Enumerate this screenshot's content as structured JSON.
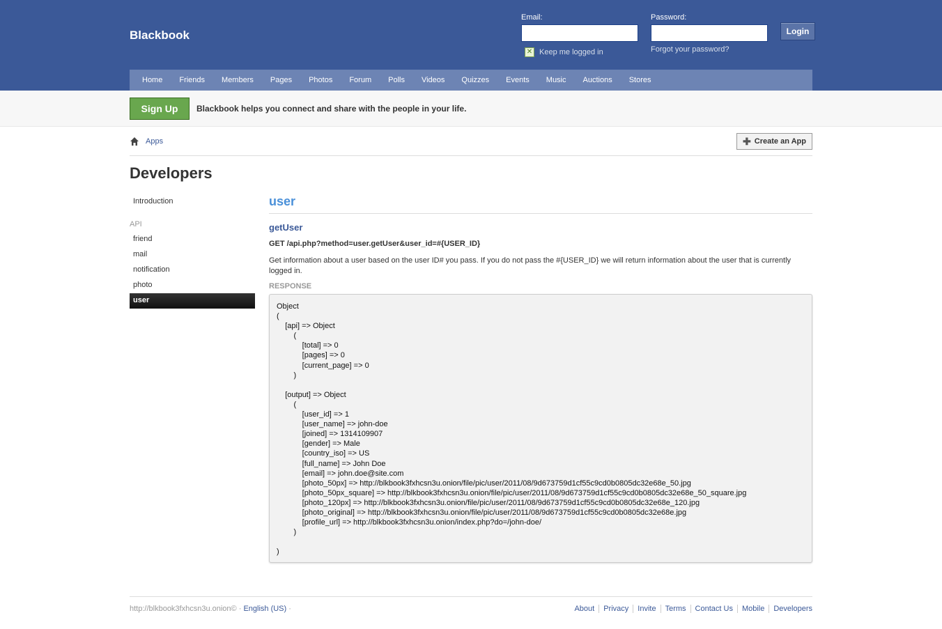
{
  "header": {
    "logo": "Blackbook",
    "email_label": "Email:",
    "password_label": "Password:",
    "email_value": "",
    "password_value": "",
    "login_label": "Login",
    "keep_logged_in": "Keep me logged in",
    "forgot_password": "Forgot your password?"
  },
  "nav": [
    "Home",
    "Friends",
    "Members",
    "Pages",
    "Photos",
    "Forum",
    "Polls",
    "Videos",
    "Quizzes",
    "Events",
    "Music",
    "Auctions",
    "Stores"
  ],
  "signup": {
    "button": "Sign Up",
    "tagline": "Blackbook helps you connect and share with the people in your life."
  },
  "breadcrumb": {
    "item": "Apps"
  },
  "create_app_label": "Create an App",
  "page_title": "Developers",
  "sidebar": {
    "intro": "Introduction",
    "section": "API",
    "items": [
      "friend",
      "mail",
      "notification",
      "photo",
      "user"
    ],
    "active": "user"
  },
  "content": {
    "title": "user",
    "method": "getUser",
    "endpoint": "GET /api.php?method=user.getUser&user_id=#{USER_ID}",
    "description": "Get information about a user based on the user ID# you pass. If you do not pass the #{USER_ID} we will return information about the user that is currently logged in.",
    "response_label": "RESPONSE",
    "response_lines": [
      "Object",
      "(",
      "    [api] => Object",
      "        (",
      "            [total] => 0",
      "            [pages] => 0",
      "            [current_page] => 0",
      "        )",
      "",
      "    [output] => Object",
      "        (",
      "            [user_id] => 1",
      "            [user_name] => john-doe",
      "            [joined] => 1314109907",
      "            [gender] => Male",
      "            [country_iso] => US",
      "            [full_name] => John Doe",
      "            [email] => john.doe@site.com",
      "            [photo_50px] => http://blkbook3fxhcsn3u.onion/file/pic/user/2011/08/9d673759d1cf55c9cd0b0805dc32e68e_50.jpg",
      "            [photo_50px_square] => http://blkbook3fxhcsn3u.onion/file/pic/user/2011/08/9d673759d1cf55c9cd0b0805dc32e68e_50_square.jpg",
      "            [photo_120px] => http://blkbook3fxhcsn3u.onion/file/pic/user/2011/08/9d673759d1cf55c9cd0b0805dc32e68e_120.jpg",
      "            [photo_original] => http://blkbook3fxhcsn3u.onion/file/pic/user/2011/08/9d673759d1cf55c9cd0b0805dc32e68e.jpg",
      "            [profile_url] => http://blkbook3fxhcsn3u.onion/index.php?do=/john-doe/",
      "        )",
      "",
      ")"
    ]
  },
  "footer": {
    "site": "http://blkbook3fxhcsn3u.onion© · ",
    "language": "English (US)",
    "trail": " ·",
    "links": [
      "About",
      "Privacy",
      "Invite",
      "Terms",
      "Contact Us",
      "Mobile",
      "Developers"
    ]
  },
  "colors": {
    "header_bg": "#3b5998",
    "nav_bg": "#6d84b4",
    "signup_green": "#69a74e",
    "title_blue": "#4a90d9"
  },
  "icons": [
    "home-icon",
    "plus-icon",
    "checkbox-checked-icon"
  ]
}
